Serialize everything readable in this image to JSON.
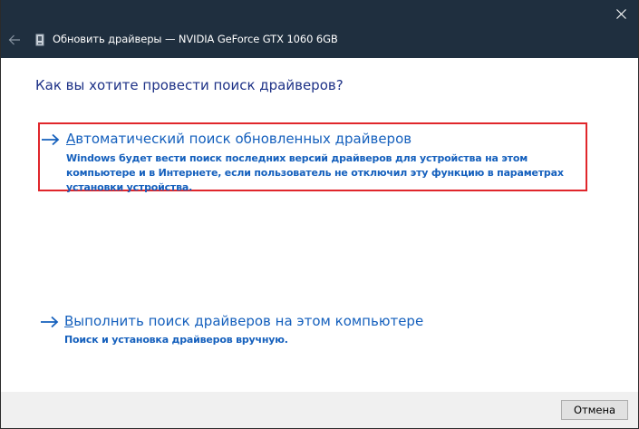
{
  "window": {
    "title": "Обновить драйверы — NVIDIA GeForce GTX 1060 6GB",
    "titlebar_color": "#1f2f3f",
    "icons": {
      "close": "close-icon",
      "back": "back-arrow-icon",
      "device": "device-icon"
    }
  },
  "main": {
    "heading": "Как вы хотите провести поиск драйверов?",
    "heading_color": "#1e3287",
    "link_color": "#1560bd",
    "highlight_color": "#e0262b",
    "options": [
      {
        "title_accel": "А",
        "title_rest": "втоматический поиск обновленных драйверов",
        "description": "Windows будет вести поиск последних версий драйверов для устройства на этом компьютере и в Интернете, если пользователь не отключил эту функцию в параметрах установки устройства.",
        "icon": "arrow-right-icon",
        "highlighted": true
      },
      {
        "title_accel": "В",
        "title_rest": "ыполнить поиск драйверов на этом компьютере",
        "description": "Поиск и установка драйверов вручную.",
        "icon": "arrow-right-icon",
        "highlighted": false
      }
    ]
  },
  "footer": {
    "cancel_label": "Отмена"
  }
}
